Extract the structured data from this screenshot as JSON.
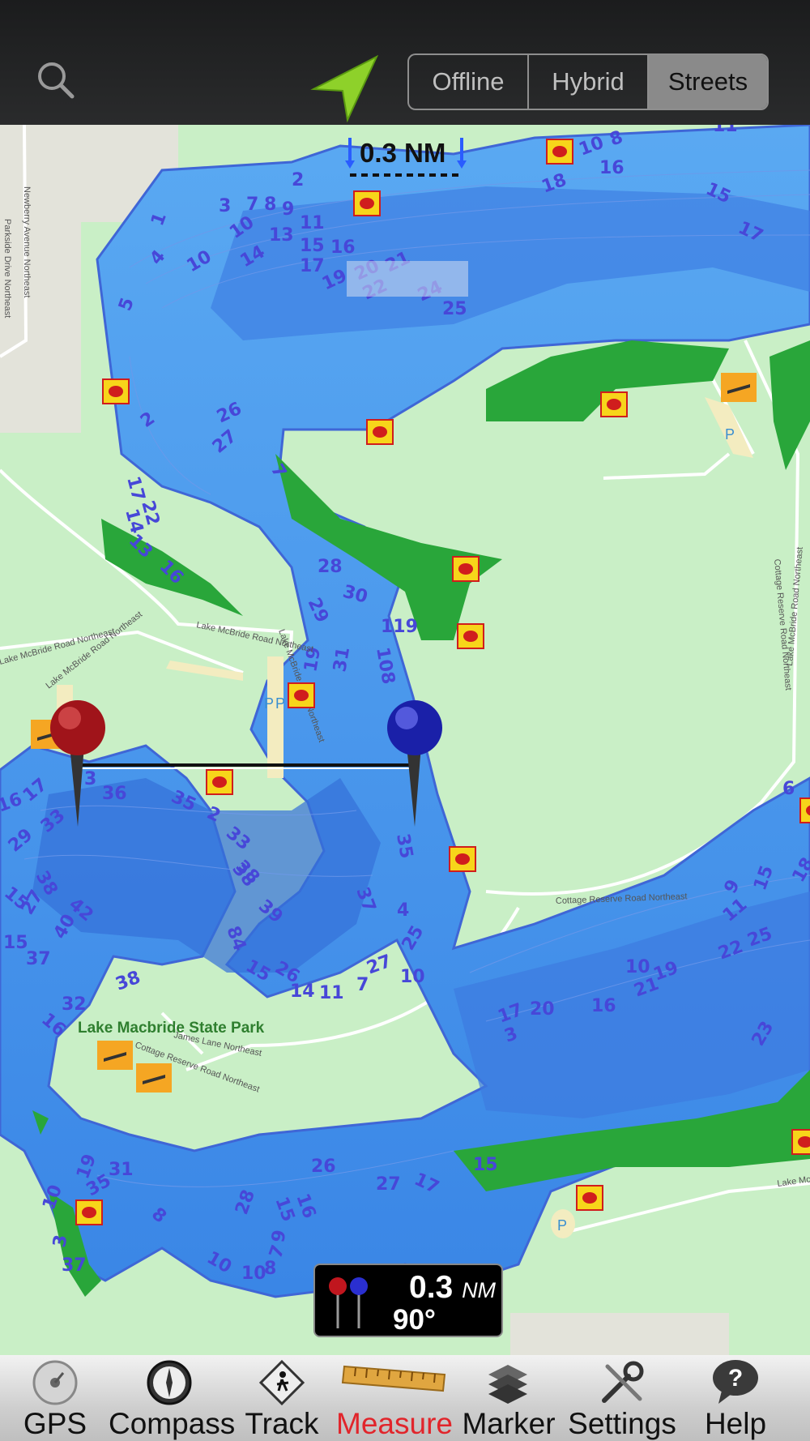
{
  "header": {
    "icons": {
      "search": "search-icon",
      "location": "navigation-arrow-icon"
    },
    "segments": [
      {
        "label": "Offline",
        "active": false
      },
      {
        "label": "Hybrid",
        "active": false
      },
      {
        "label": "Streets",
        "active": true
      }
    ]
  },
  "map": {
    "scale_label": "0.3 NM",
    "park_label": "Lake Macbride State Park",
    "road_labels": {
      "r1": "Newberry Avenue Northeast",
      "r2": "Parkside Drive Northeast",
      "r3": "Lake McBride Road Northeast",
      "r4": "Lake McBride Road Northeast",
      "r5": "Lake McBride Road Northeast",
      "r6": "Lake McBride Road Northeast",
      "r7": "Cottage Reserve Road Northeast",
      "r8": "James Lane Northeast",
      "r9": "Cottage Reserve Road Northeast",
      "r10": "Lake McBride Road Northeast",
      "r11": "Lake Mc",
      "r12": "Cottage Reserve Road Northeast"
    },
    "parking_label": "P",
    "depth_soundings": [
      "2",
      "3",
      "7",
      "8",
      "9",
      "11",
      "10",
      "13",
      "15",
      "16",
      "1",
      "4",
      "10",
      "14",
      "17",
      "19",
      "20",
      "21",
      "22",
      "24",
      "25",
      "5",
      "18",
      "16",
      "10",
      "8",
      "15",
      "17",
      "11",
      "2",
      "26",
      "27",
      "7",
      "17",
      "14",
      "22",
      "13",
      "16",
      "28",
      "30",
      "29",
      "119",
      "31",
      "108",
      "19",
      "3",
      "36",
      "35",
      "2",
      "33",
      "16",
      "17",
      "33",
      "38",
      "29",
      "15",
      "38",
      "42",
      "27",
      "40",
      "15",
      "37",
      "38",
      "39",
      "37",
      "35",
      "84",
      "15",
      "26",
      "14",
      "11",
      "7",
      "27",
      "10",
      "25",
      "4",
      "6",
      "15",
      "18",
      "9",
      "11",
      "10",
      "21",
      "19",
      "22",
      "25",
      "23",
      "16",
      "17",
      "20",
      "3",
      "32",
      "16",
      "38",
      "31",
      "19",
      "35",
      "8",
      "10",
      "3",
      "37",
      "28",
      "15",
      "16",
      "26",
      "27",
      "17",
      "9",
      "7",
      "8",
      "10",
      "10",
      "15"
    ],
    "fishing_icon": "fish-spot-icon",
    "ramp_icon": "boat-ramp-icon",
    "pins": {
      "start": "red-pin-icon",
      "end": "blue-pin-icon"
    }
  },
  "readout": {
    "distance": "0.3",
    "unit": "NM",
    "bearing": "90°"
  },
  "tabbar": [
    {
      "label": "GPS",
      "icon": "gps-icon",
      "active": false
    },
    {
      "label": "Compass",
      "icon": "compass-icon",
      "active": false
    },
    {
      "label": "Track",
      "icon": "track-icon",
      "active": false
    },
    {
      "label": "Measure",
      "icon": "ruler-icon",
      "active": true
    },
    {
      "label": "Marker",
      "icon": "marker-icon",
      "active": false
    },
    {
      "label": "Settings",
      "icon": "settings-icon",
      "active": false
    },
    {
      "label": "Help",
      "icon": "help-icon",
      "active": false
    }
  ]
}
